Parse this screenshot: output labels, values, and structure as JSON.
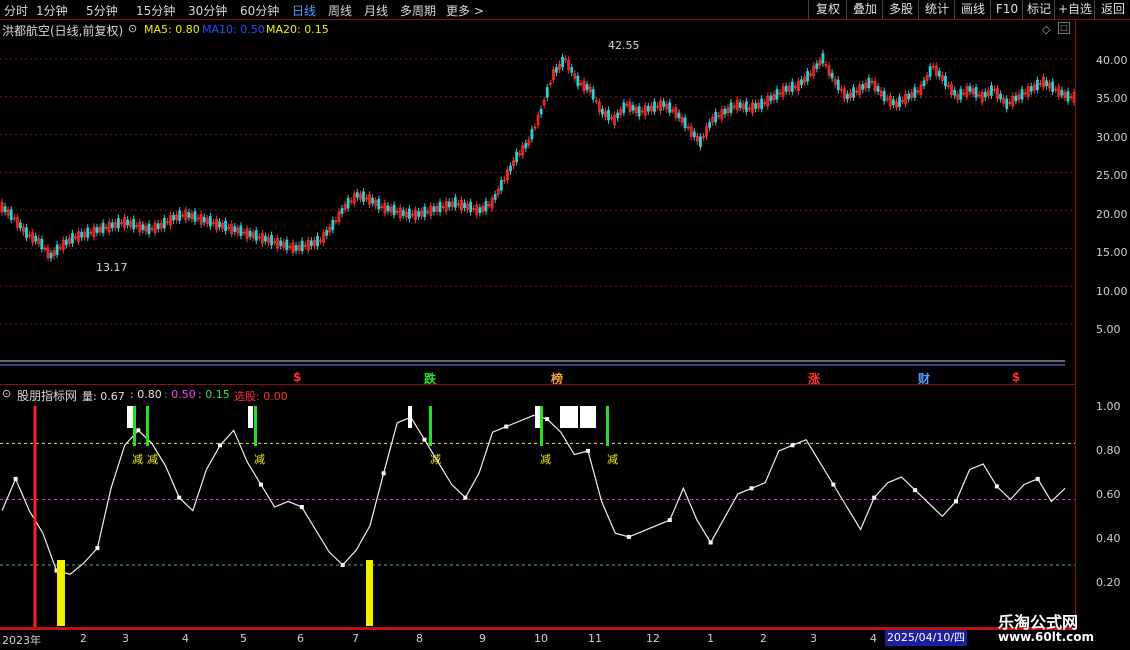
{
  "toolbar": {
    "periods": [
      "分时",
      "1分钟",
      "5分钟",
      "15分钟",
      "30分钟",
      "60分钟",
      "日线",
      "周线",
      "月线",
      "多周期",
      "更多 >"
    ],
    "active_period": "日线",
    "right_buttons": [
      "复权",
      "叠加",
      "多股",
      "统计",
      "画线",
      "F10",
      "标记",
      "+自选",
      "返回"
    ]
  },
  "main_chart": {
    "stock_title": "洪都航空(日线,前复权)",
    "ma5_label": "MA5: 0.80",
    "ma10_label": "MA10: 0.50",
    "ma20_label": "MA20: 0.15",
    "high_label": "42.55",
    "low_label": "13.17",
    "price_ticks": [
      "40.00",
      "35.00",
      "30.00",
      "25.00",
      "20.00",
      "15.00",
      "10.00",
      "5.00"
    ],
    "event_tags": [
      {
        "text": "$",
        "color": "#ff3030"
      },
      {
        "text": "跌",
        "color": "#30e030"
      },
      {
        "text": "榜",
        "color": "#f0a040"
      },
      {
        "text": "涨",
        "color": "#ff3030"
      },
      {
        "text": "财",
        "color": "#4aa0ff"
      },
      {
        "text": "$",
        "color": "#ff3030"
      }
    ]
  },
  "indicator": {
    "name": "股朋指标网",
    "vol_label": "量: 0.67",
    "v2": ": 0.80",
    "v3": ": 0.50",
    "v4": ": 0.15",
    "pick_label": "选股: 0.00",
    "ticks": [
      "1.00",
      "0.80",
      "0.60",
      "0.40",
      "0.20"
    ],
    "signal_text": "减"
  },
  "x_axis": {
    "labels": [
      "2023年",
      "2",
      "3",
      "4",
      "5",
      "6",
      "7",
      "8",
      "9",
      "10",
      "11",
      "12",
      "1",
      "2",
      "3",
      "4"
    ],
    "current_date": "2025/04/10/四"
  },
  "watermark": {
    "site_name": "乐淘公式网",
    "url": "www.60lt.com"
  },
  "colors": {
    "axis_red": "#8a1010",
    "up": "#ff3030",
    "down": "#30d0d0",
    "signal_green": "#20e020",
    "signal_yellow": "#f0f000"
  },
  "chart_data": {
    "type": "line",
    "x_unit": "month",
    "price_close": [
      20.5,
      19,
      17,
      16,
      14,
      15.5,
      16.5,
      17,
      17.5,
      18,
      18.5,
      18,
      17.5,
      18,
      19,
      19.5,
      19,
      18.5,
      18,
      17.5,
      17,
      16.5,
      16,
      15.5,
      15,
      15.5,
      16,
      18,
      20.5,
      22,
      21.5,
      20.5,
      20,
      19.5,
      19.5,
      20,
      20.5,
      21,
      20.5,
      20,
      21,
      24,
      27,
      29,
      33,
      38,
      40,
      37,
      36,
      33,
      32,
      34,
      33,
      33.5,
      34,
      33,
      31,
      29,
      32,
      33,
      34,
      33.5,
      34,
      35,
      36,
      36.5,
      38,
      40,
      37,
      35,
      36,
      37,
      35,
      34,
      35,
      36,
      39,
      37,
      35,
      36,
      35,
      36,
      34,
      35,
      36,
      37,
      36,
      35
    ],
    "oscillator": [
      0.5,
      0.55,
      0.4,
      0.3,
      0.12,
      0.1,
      0.2,
      0.3,
      0.5,
      0.75,
      0.85,
      0.8,
      0.7,
      0.55,
      0.5,
      0.6,
      0.75,
      0.85,
      0.7,
      0.6,
      0.5,
      0.55,
      0.4,
      0.3,
      0.2,
      0.15,
      0.25,
      0.4,
      0.7,
      0.85,
      0.9,
      0.8,
      0.7,
      0.6,
      0.55,
      0.7,
      0.8,
      0.85,
      0.9,
      0.95,
      0.95,
      0.9,
      0.8,
      0.7,
      0.45,
      0.3,
      0.3,
      0.35,
      0.4,
      0.45,
      0.5,
      0.35,
      0.25,
      0.4,
      0.55,
      0.6,
      0.65,
      0.7,
      0.75,
      0.8,
      0.7,
      0.6,
      0.5,
      0.4,
      0.45,
      0.55,
      0.6,
      0.55,
      0.5,
      0.45,
      0.55,
      0.6,
      0.65,
      0.55,
      0.5,
      0.6,
      0.65,
      0.55,
      0.5
    ],
    "levels": {
      "upper": 0.8,
      "middle": 0.5,
      "lower": 0.15
    },
    "ylim_price": [
      0,
      45
    ],
    "ylim_indicator": [
      0.05,
      1.05
    ]
  }
}
